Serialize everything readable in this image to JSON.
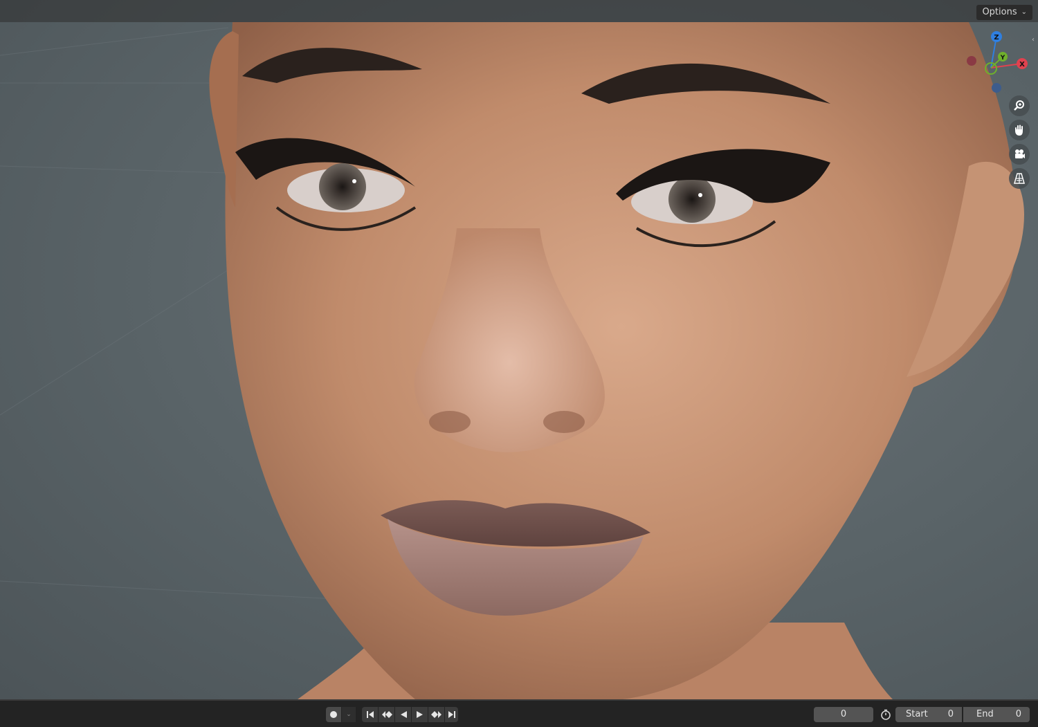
{
  "header": {
    "options_label": "Options"
  },
  "gizmo": {
    "axes": [
      {
        "label": "Z",
        "color": "#2f7fe0"
      },
      {
        "label": "Y",
        "color": "#6fb02c"
      },
      {
        "label": "X",
        "color": "#e0424f"
      }
    ]
  },
  "nav_buttons": [
    "zoom-icon",
    "hand-pan-icon",
    "camera-icon",
    "perspective-grid-icon"
  ],
  "timeline": {
    "current_frame": "0",
    "start_label": "Start",
    "start_value": "0",
    "end_label": "End",
    "end_value": "0"
  },
  "colors": {
    "viewport_bg": "#596367",
    "header_bg": "#2d2d2d",
    "timeline_bg": "#232323",
    "field_bg": "#545454"
  }
}
